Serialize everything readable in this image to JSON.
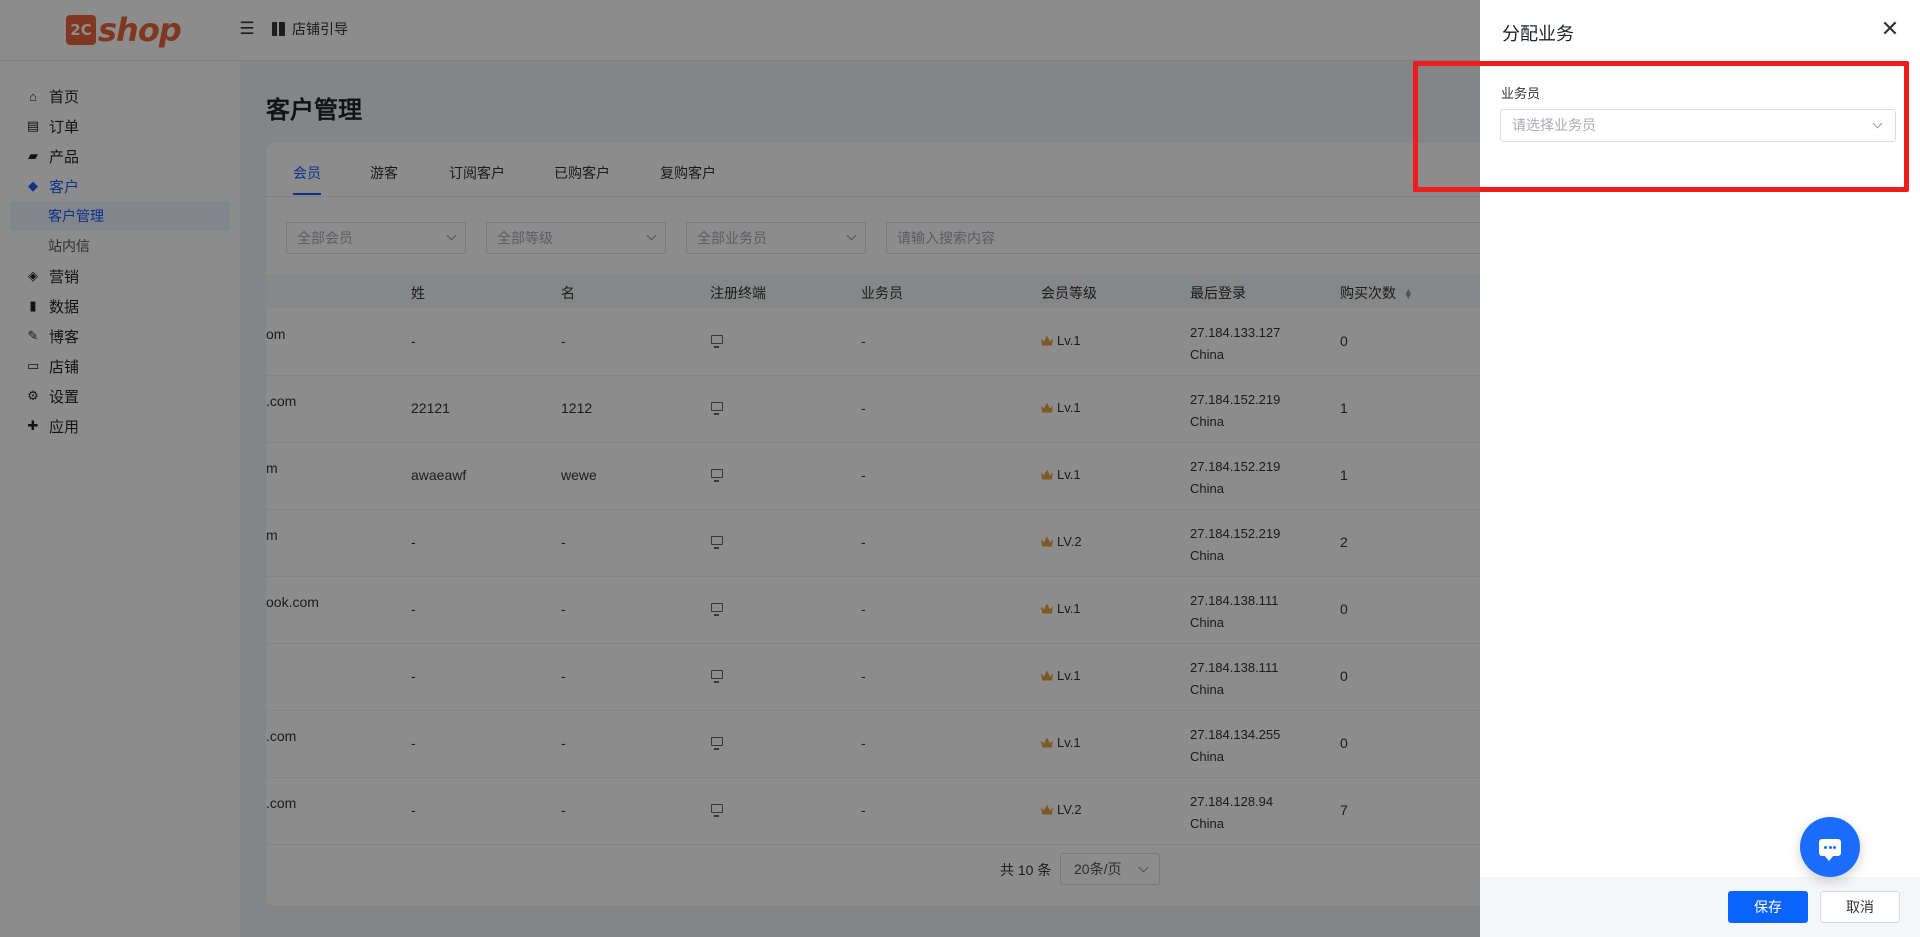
{
  "logo": {
    "badge": "2C",
    "text": "shop",
    "color": "#e8663a"
  },
  "header": {
    "store_guide": "店铺引导"
  },
  "sidebar": {
    "items": [
      {
        "label": "首页",
        "icon": "home-icon"
      },
      {
        "label": "订单",
        "icon": "clipboard-icon"
      },
      {
        "label": "产品",
        "icon": "bag-icon"
      },
      {
        "label": "客户",
        "icon": "diamond-icon"
      },
      {
        "label": "营销",
        "icon": "tag-icon"
      },
      {
        "label": "数据",
        "icon": "bar-chart-icon"
      },
      {
        "label": "博客",
        "icon": "edit-icon"
      },
      {
        "label": "店铺",
        "icon": "store-icon"
      },
      {
        "label": "设置",
        "icon": "gear-icon"
      },
      {
        "label": "应用",
        "icon": "puzzle-icon"
      }
    ],
    "sub_items": [
      {
        "label": "客户管理"
      },
      {
        "label": "站内信"
      }
    ]
  },
  "main": {
    "title": "客户管理",
    "tabs": [
      {
        "label": "会员"
      },
      {
        "label": "游客"
      },
      {
        "label": "订阅客户"
      },
      {
        "label": "已购客户"
      },
      {
        "label": "复购客户"
      }
    ],
    "filters": {
      "member": "全部会员",
      "level": "全部等级",
      "salesperson": "全部业务员",
      "search_placeholder": "请输入搜索内容"
    },
    "columns": [
      "姓",
      "名",
      "注册终端",
      "业务员",
      "会员等级",
      "最后登录",
      "购买次数"
    ],
    "rows": [
      {
        "email": "om",
        "last_name": "-",
        "first_name": "-",
        "salesperson": "-",
        "level": "Lv.1",
        "ip": "27.184.133.127",
        "country": "China",
        "purchases": "0"
      },
      {
        "email": ".com",
        "last_name": "22121",
        "first_name": "1212",
        "salesperson": "-",
        "level": "Lv.1",
        "ip": "27.184.152.219",
        "country": "China",
        "purchases": "1"
      },
      {
        "email": "m",
        "last_name": "awaeawf",
        "first_name": "wewe",
        "salesperson": "-",
        "level": "Lv.1",
        "ip": "27.184.152.219",
        "country": "China",
        "purchases": "1"
      },
      {
        "email": "m",
        "last_name": "-",
        "first_name": "-",
        "salesperson": "-",
        "level": "LV.2",
        "ip": "27.184.152.219",
        "country": "China",
        "purchases": "2"
      },
      {
        "email": "ook.com",
        "last_name": "-",
        "first_name": "-",
        "salesperson": "-",
        "level": "Lv.1",
        "ip": "27.184.138.111",
        "country": "China",
        "purchases": "0"
      },
      {
        "email": "",
        "last_name": "-",
        "first_name": "-",
        "salesperson": "-",
        "level": "Lv.1",
        "ip": "27.184.138.111",
        "country": "China",
        "purchases": "0"
      },
      {
        "email": ".com",
        "last_name": "-",
        "first_name": "-",
        "salesperson": "-",
        "level": "Lv.1",
        "ip": "27.184.134.255",
        "country": "China",
        "purchases": "0"
      },
      {
        "email": ".com",
        "last_name": "-",
        "first_name": "-",
        "salesperson": "-",
        "level": "LV.2",
        "ip": "27.184.128.94",
        "country": "China",
        "purchases": "7"
      }
    ],
    "pagination": {
      "total": "共 10 条",
      "page_size": "20条/页"
    }
  },
  "drawer": {
    "title": "分配业务",
    "field_label": "业务员",
    "select_placeholder": "请选择业务员",
    "save": "保存",
    "cancel": "取消"
  },
  "colors": {
    "accent": "#1a5cff",
    "highlight": "#ee1c1c",
    "brand": "#e8663a"
  }
}
